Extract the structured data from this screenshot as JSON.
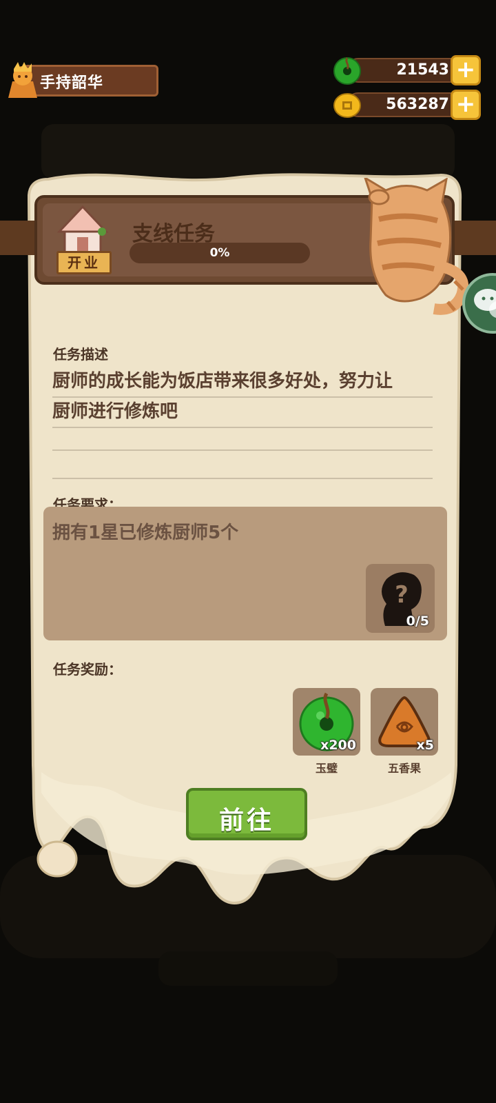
{
  "player": {
    "name": "手持韶华"
  },
  "currencies": [
    {
      "name": "jade",
      "value": "21543",
      "color": "#33c033"
    },
    {
      "name": "coin",
      "value": "563287",
      "color": "#f2b81c"
    }
  ],
  "task": {
    "title": "支线任务",
    "progress_text": "0%",
    "progress": 0,
    "shop_tag": "开业",
    "description_label": "任务描述",
    "description_lines": [
      "厨师的成长能为饭店带来很多好处，努力让",
      "厨师进行修炼吧"
    ],
    "requirement_label": "任务要求：",
    "requirement_text": "拥有1星已修炼厨师5个",
    "requirement_progress": "0/5",
    "reward_label": "任务奖励：",
    "rewards": [
      {
        "name": "玉璧",
        "qty": "x200",
        "icon": "jade-disc-icon"
      },
      {
        "name": "五香果",
        "qty": "x5",
        "icon": "five-spice-fruit-icon"
      }
    ],
    "go_button": "前往"
  }
}
